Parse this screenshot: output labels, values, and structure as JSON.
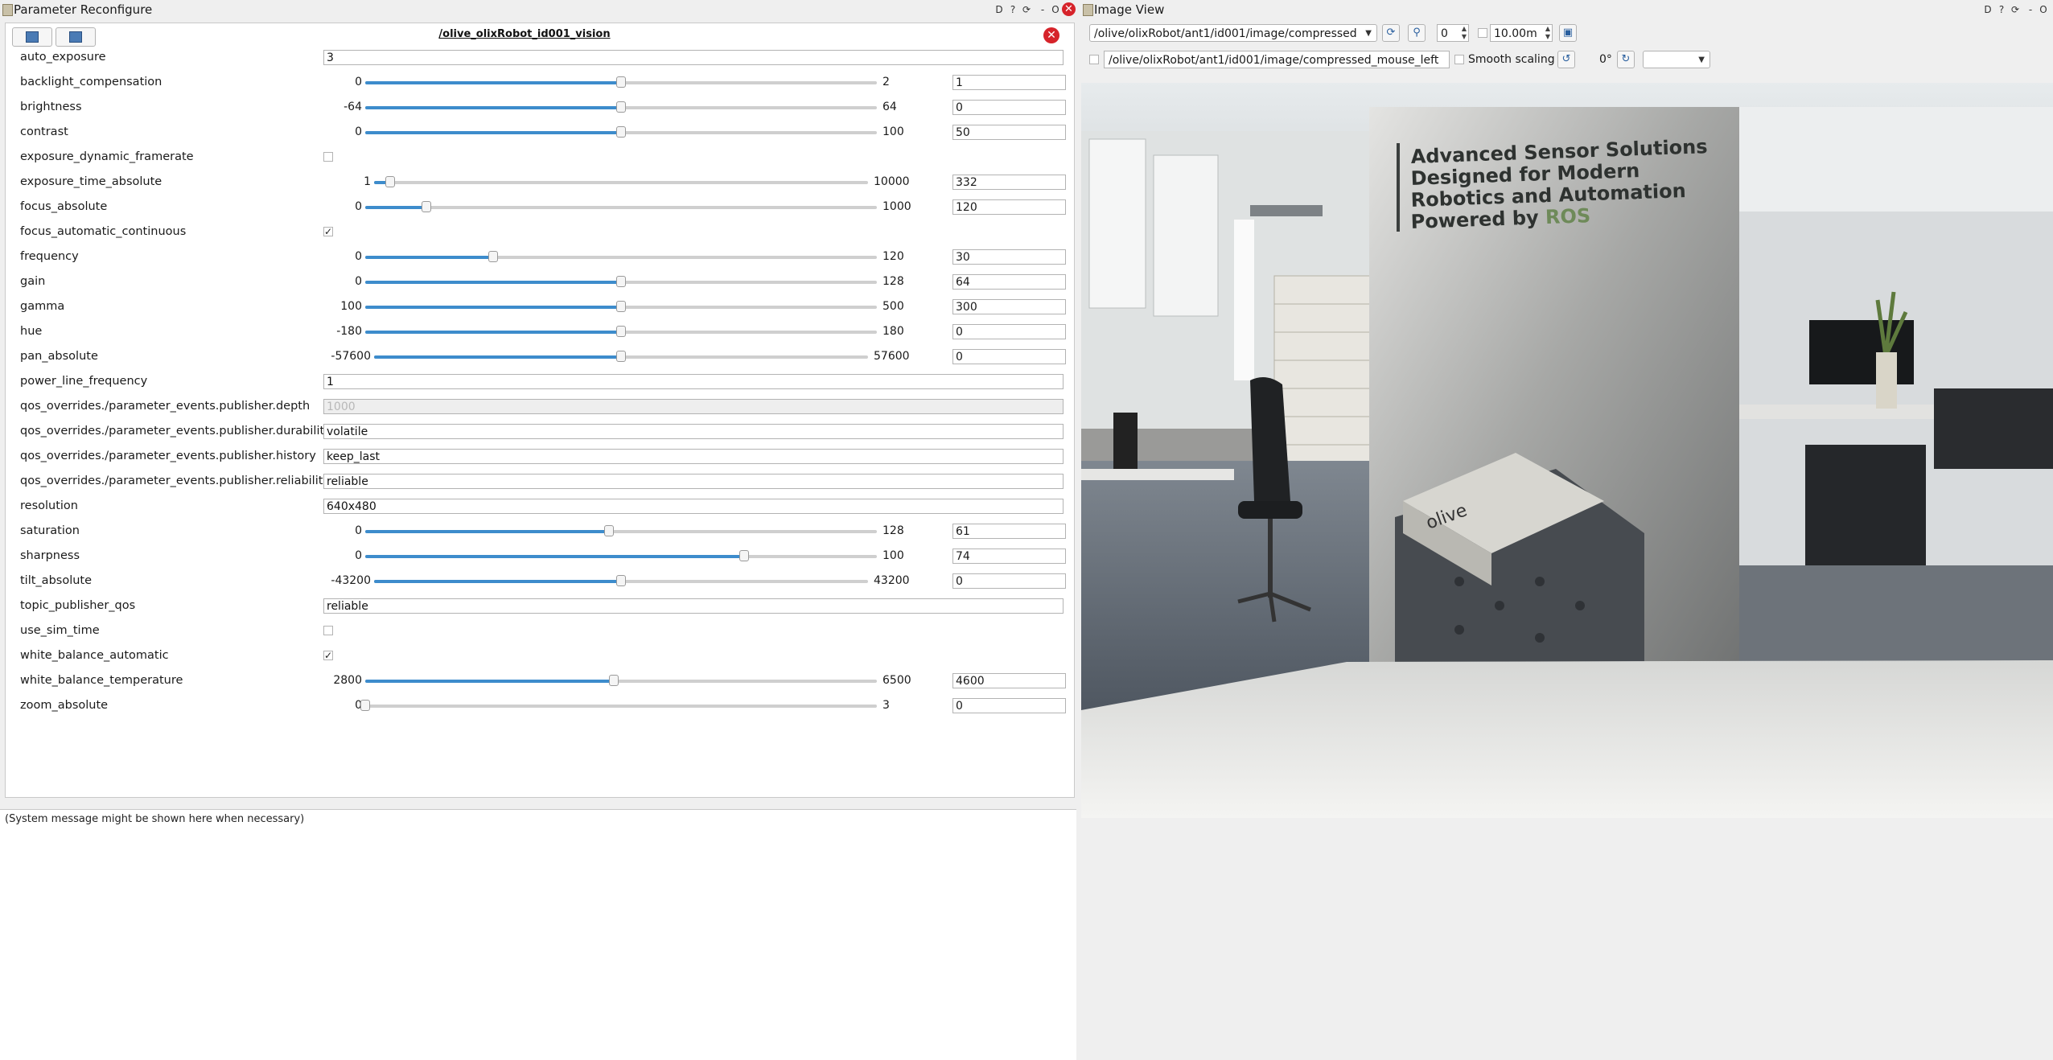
{
  "left_window": {
    "title": "Parameter Reconfigure",
    "title_buttons": [
      "D",
      "?",
      "-",
      "O"
    ],
    "node_title": "/olive_olixRobot_id001_vision",
    "message": "(System message might be shown here when necessary)",
    "params": [
      {
        "name": "auto_exposure",
        "kind": "text",
        "value": "3"
      },
      {
        "name": "backlight_compensation",
        "kind": "slider",
        "min": "0",
        "max": "2",
        "value": "1",
        "fraction": 0.5
      },
      {
        "name": "brightness",
        "kind": "slider",
        "min": "-64",
        "max": "64",
        "value": "0",
        "fraction": 0.5
      },
      {
        "name": "contrast",
        "kind": "slider",
        "min": "0",
        "max": "100",
        "value": "50",
        "fraction": 0.5
      },
      {
        "name": "exposure_dynamic_framerate",
        "kind": "check",
        "checked": false
      },
      {
        "name": "exposure_time_absolute",
        "kind": "slider",
        "min": "1",
        "max": "10000",
        "value": "332",
        "fraction": 0.033
      },
      {
        "name": "focus_absolute",
        "kind": "slider",
        "min": "0",
        "max": "1000",
        "value": "120",
        "fraction": 0.12
      },
      {
        "name": "focus_automatic_continuous",
        "kind": "check",
        "checked": true
      },
      {
        "name": "frequency",
        "kind": "slider",
        "min": "0",
        "max": "120",
        "value": "30",
        "fraction": 0.25
      },
      {
        "name": "gain",
        "kind": "slider",
        "min": "0",
        "max": "128",
        "value": "64",
        "fraction": 0.5
      },
      {
        "name": "gamma",
        "kind": "slider",
        "min": "100",
        "max": "500",
        "value": "300",
        "fraction": 0.5
      },
      {
        "name": "hue",
        "kind": "slider",
        "min": "-180",
        "max": "180",
        "value": "0",
        "fraction": 0.5
      },
      {
        "name": "pan_absolute",
        "kind": "slider",
        "min": "-57600",
        "max": "57600",
        "value": "0",
        "fraction": 0.5
      },
      {
        "name": "power_line_frequency",
        "kind": "text",
        "value": "1"
      },
      {
        "name": "qos_overrides./parameter_events.publisher.depth",
        "kind": "text",
        "value": "1000",
        "disabled": true
      },
      {
        "name": "qos_overrides./parameter_events.publisher.durability",
        "kind": "text",
        "value": "volatile"
      },
      {
        "name": "qos_overrides./parameter_events.publisher.history",
        "kind": "text",
        "value": "keep_last"
      },
      {
        "name": "qos_overrides./parameter_events.publisher.reliability",
        "kind": "text",
        "value": "reliable"
      },
      {
        "name": "resolution",
        "kind": "text",
        "value": "640x480"
      },
      {
        "name": "saturation",
        "kind": "slider",
        "min": "0",
        "max": "128",
        "value": "61",
        "fraction": 0.477
      },
      {
        "name": "sharpness",
        "kind": "slider",
        "min": "0",
        "max": "100",
        "value": "74",
        "fraction": 0.74
      },
      {
        "name": "tilt_absolute",
        "kind": "slider",
        "min": "-43200",
        "max": "43200",
        "value": "0",
        "fraction": 0.5
      },
      {
        "name": "topic_publisher_qos",
        "kind": "text",
        "value": "reliable"
      },
      {
        "name": "use_sim_time",
        "kind": "check",
        "checked": false
      },
      {
        "name": "white_balance_automatic",
        "kind": "check",
        "checked": true
      },
      {
        "name": "white_balance_temperature",
        "kind": "slider",
        "min": "2800",
        "max": "6500",
        "value": "4600",
        "fraction": 0.486
      },
      {
        "name": "zoom_absolute",
        "kind": "slider",
        "min": "0",
        "max": "3",
        "value": "0",
        "fraction": 0.0
      }
    ]
  },
  "right_window": {
    "title": "Image View",
    "title_buttons": [
      "D",
      "?",
      "-",
      "O"
    ],
    "topic": "/olive/olixRobot/ant1/id001/image/compressed",
    "zoom_value": "0",
    "max_range": "10.00m",
    "mouse_topic": "/olive/olixRobot/ant1/id001/image/compressed_mouse_left",
    "smooth_scaling_label": "Smooth scaling",
    "rotation": "0°",
    "image": {
      "banner_lines": [
        "Advanced Sensor Solutions",
        "Designed for Modern",
        "Robotics and Automation",
        "Powered by "
      ],
      "banner_highlight": "ROS",
      "device_label": "olive"
    }
  },
  "icons": {
    "load": "folder-open-icon",
    "save": "save-icon",
    "refresh": "refresh-icon",
    "zoom": "zoom-icon",
    "save_image": "save-image-icon",
    "rotate_left": "rotate-left-icon",
    "rotate_right": "rotate-right-icon"
  },
  "colors": {
    "slider_fill": "#3d8ccc",
    "close_red": "#d6232a"
  }
}
